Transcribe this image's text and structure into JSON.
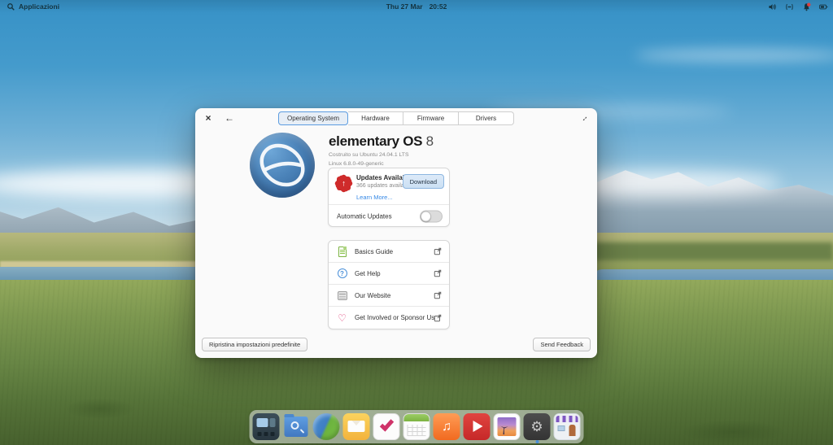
{
  "panel": {
    "app_menu_label": "Applicazioni",
    "date": "Thu 27 Mar",
    "time": "20:52",
    "indicator_icons": [
      "volume-icon",
      "network-icon",
      "notifications-icon",
      "battery-icon"
    ],
    "notification_badge": true
  },
  "window": {
    "titlebar": {
      "close_icon": "×",
      "back_icon": "←",
      "maximize_icon": "↔",
      "tabs": [
        {
          "label": "Operating System",
          "selected": true
        },
        {
          "label": "Hardware",
          "selected": false
        },
        {
          "label": "Firmware",
          "selected": false
        },
        {
          "label": "Drivers",
          "selected": false
        }
      ]
    },
    "os": {
      "logo": "elementary-logo",
      "title": "elementary OS",
      "version": "8",
      "built_on": "Costruito su Ubuntu 24.04.1 LTS",
      "kernel": "Linux 6.8.0-49-generic"
    },
    "updates": {
      "badge_icon": "updates-badge-icon",
      "badge_arrow": "↑",
      "title": "Updates Available",
      "subtitle": "366 updates available",
      "download_label": "Download",
      "learn_more_label": "Learn More...",
      "automatic_label": "Automatic Updates",
      "automatic_enabled": false
    },
    "links": [
      {
        "label": "Basics Guide",
        "icon": "document-icon"
      },
      {
        "label": "Get Help",
        "icon": "help-icon",
        "glyph": "?"
      },
      {
        "label": "Our Website",
        "icon": "globe-icon"
      },
      {
        "label": "Get Involved or Sponsor Us",
        "icon": "heart-icon",
        "glyph": "♡"
      }
    ],
    "footer": {
      "restore_label": "Ripristina impostazioni predefinite",
      "feedback_label": "Send Feedback"
    }
  },
  "dock": {
    "items": [
      {
        "name": "multitasking-view"
      },
      {
        "name": "files"
      },
      {
        "name": "web-browser"
      },
      {
        "name": "mail"
      },
      {
        "name": "tasks"
      },
      {
        "name": "calendar"
      },
      {
        "name": "music",
        "glyph": "♫"
      },
      {
        "name": "videos"
      },
      {
        "name": "photos"
      },
      {
        "name": "settings",
        "glyph": "⚙",
        "running": true
      },
      {
        "name": "appcenter"
      }
    ]
  },
  "colors": {
    "accent_blue": "#3689e6",
    "selected_tab_border": "#5c9ce0",
    "download_button_bg": "#cbe0f4",
    "updates_badge_red": "#cf2b2b",
    "heart_pink": "#e0457b",
    "doc_green": "#7cb342",
    "running_dot": "#4a90d9",
    "window_bg": "#fafafa"
  }
}
